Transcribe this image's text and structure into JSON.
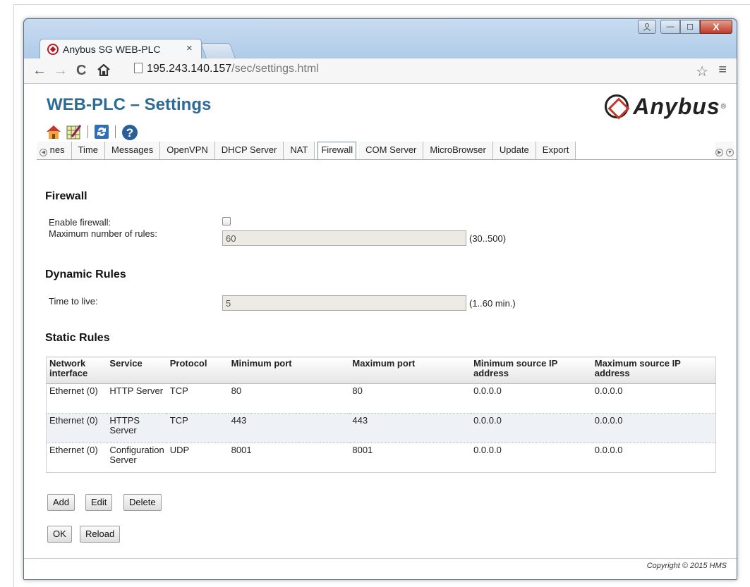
{
  "browser": {
    "tab_title": "Anybus SG WEB-PLC",
    "tab_close": "×",
    "url_host": "195.243.140.157",
    "url_path": "/sec/settings.html"
  },
  "window_controls": {
    "minimize": "—",
    "maximize": "☐",
    "close": "X"
  },
  "page": {
    "title": "WEB-PLC – Settings",
    "logo_text": "Anybus",
    "logo_reg": "®"
  },
  "toolbar_icons": [
    "home-icon",
    "grid-edit-icon",
    "refresh-icon",
    "help-icon"
  ],
  "tabs": {
    "items": [
      {
        "label": "nes"
      },
      {
        "label": "Time"
      },
      {
        "label": "Messages"
      },
      {
        "label": "OpenVPN"
      },
      {
        "label": "DHCP Server"
      },
      {
        "label": "NAT"
      },
      {
        "label": "Firewall",
        "active": true
      },
      {
        "label": "COM Server"
      },
      {
        "label": "MicroBrowser"
      },
      {
        "label": "Update"
      },
      {
        "label": "Export"
      }
    ]
  },
  "firewall": {
    "heading": "Firewall",
    "enable_label": "Enable firewall:",
    "enable_checked": false,
    "max_rules_label": "Maximum number of rules:",
    "max_rules_value": "60",
    "max_rules_range": "(30..500)"
  },
  "dynamic": {
    "heading": "Dynamic Rules",
    "ttl_label": "Time to live:",
    "ttl_value": "5",
    "ttl_range": "(1..60 min.)"
  },
  "static": {
    "heading": "Static Rules",
    "columns": [
      "Network interface",
      "Service",
      "Protocol",
      "Minimum port",
      "Maximum port",
      "Minimum source IP address",
      "Maximum source IP address"
    ],
    "rows": [
      [
        "Ethernet (0)",
        "HTTP Server",
        "TCP",
        "80",
        "80",
        "0.0.0.0",
        "0.0.0.0"
      ],
      [
        "Ethernet (0)",
        "HTTPS Server",
        "TCP",
        "443",
        "443",
        "0.0.0.0",
        "0.0.0.0"
      ],
      [
        "Ethernet (0)",
        "Configuration Server",
        "UDP",
        "8001",
        "8001",
        "0.0.0.0",
        "0.0.0.0"
      ]
    ]
  },
  "buttons": {
    "add": "Add",
    "edit": "Edit",
    "delete": "Delete",
    "ok": "OK",
    "reload": "Reload"
  },
  "footer": {
    "copyright": "Copyright © 2015 HMS"
  }
}
